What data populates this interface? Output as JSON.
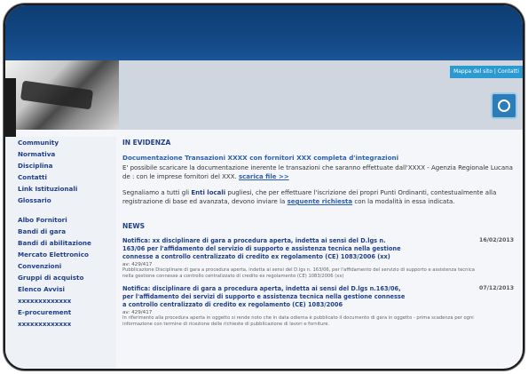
{
  "header": {
    "map_button": "Mappa del sito | Contatti"
  },
  "sidebar": {
    "group1": [
      {
        "label": "Community"
      },
      {
        "label": "Normativa"
      },
      {
        "label": "Disciplina"
      },
      {
        "label": "Contatti"
      },
      {
        "label": "Link Istituzionali"
      },
      {
        "label": "Glossario"
      }
    ],
    "group2": [
      {
        "label": "Albo Fornitori"
      },
      {
        "label": "Bandi di gara"
      },
      {
        "label": "Bandi di abilitazione"
      },
      {
        "label": "Mercato Elettronico"
      },
      {
        "label": "Convenzioni"
      },
      {
        "label": "Gruppi di acquisto"
      },
      {
        "label": "Elenco Avvisi"
      },
      {
        "label": "xxxxxxxxxxxxx"
      },
      {
        "label": "E-procurement"
      },
      {
        "label": "xxxxxxxxxxxxx"
      }
    ]
  },
  "evidence": {
    "title": "IN EVIDENZA",
    "link": "Documentazione Transazioni XXXX con fornitori XXX completa d'integrazioni",
    "para1_pre": "E' possibile scaricare la documentazione inerente le transazioni che saranno effettuate dall'XXXX - Agenzia Regionale Lucana de",
    "para1_post": ": con le imprese fornitori del XXX.",
    "para1_link": "scarica file >>",
    "para2_pre": "Segnaliamo a tutti gli",
    "para2_bold": "Enti locali",
    "para2_mid": "pugliesi, che per effettuare l'iscrizione",
    "para2_end": "dei propri Punti Ordinanti, contestualmente alla registrazione di base ed avanzata, devono inviare la",
    "para2_link": "seguente richiesta",
    "para2_tail": "con la modalità in essa indicata."
  },
  "news": {
    "title": "NEWS",
    "items": [
      {
        "title": "Notifica: xx disciplinare di gara a procedura aperta, indetta ai sensi del D.lgs n. 163/06 per l'affidamento del servizio di supporto e assistenza tecnica nella gestione connesse a controllo centralizzato di credito ex regolamento (CE) 1083/2006 (xx)",
        "date": "16/02/2013",
        "ref": "av: 429/417",
        "body": "Pubblicazione Disciplinare di gara a procedura aperta, indetta ai sensi del D.lgs n. 163/06, per l'affidamento del servizio di supporto e assistenza tecnica nella gestione connesse a controllo centralizzato di credito ex regolamento (CE) 1083/2006 (xx)"
      },
      {
        "title": "Notifica: disciplinare di gara a procedura aperta, indetta ai sensi del D.lgs n.163/06, per l'affidamento dei servizi di supporto e assistenza tecnica nella gestione connesse a controllo centralizzato di credito ex regolamento (CE) 1083/2006",
        "date": "07/12/2013",
        "ref": "av: 429/417",
        "body": "In riferimento alla procedura aperta in oggetto si rende noto che in data odierna è pubblicato il documento di gara in oggetto - prima scadenza per ogni informazione con termine di ricezione delle richieste di pubblicazione di lavori e forniture."
      }
    ]
  }
}
